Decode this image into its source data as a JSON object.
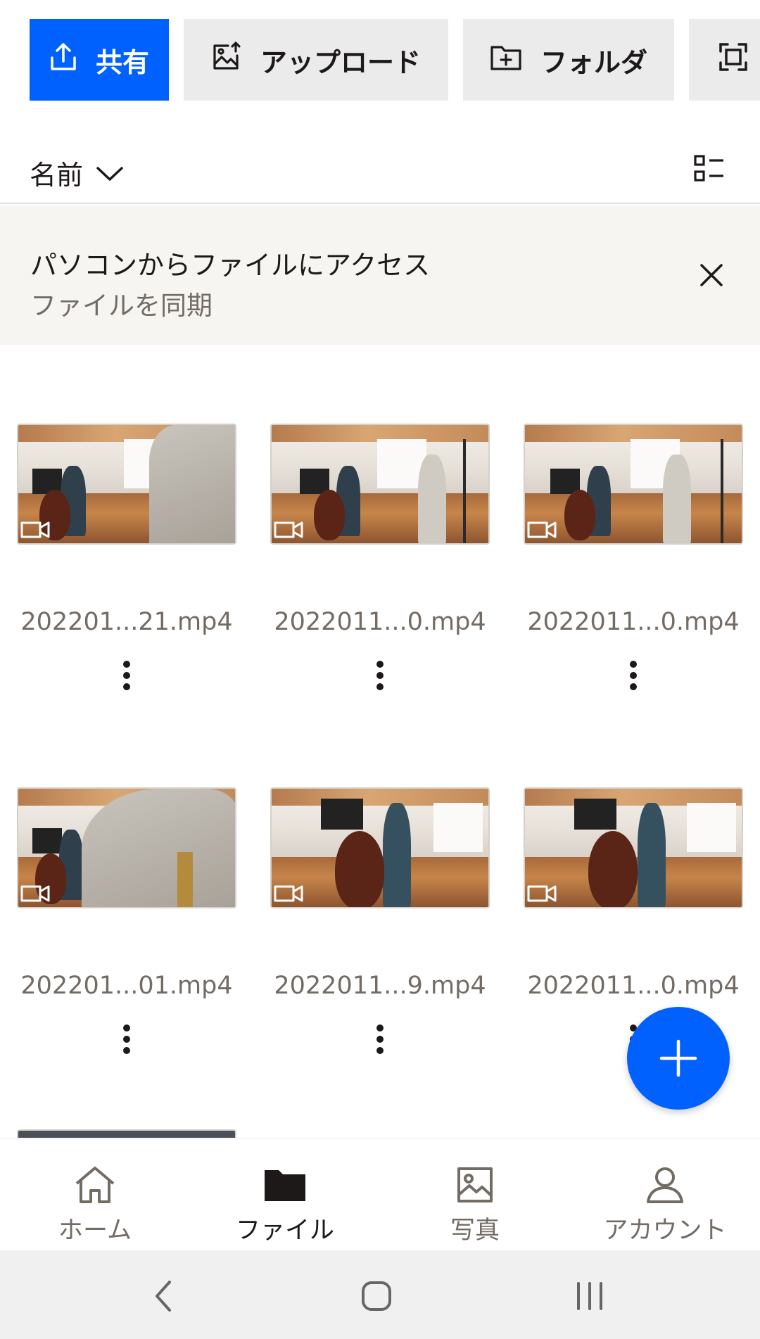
{
  "toolbar": {
    "share_label": "共有",
    "upload_label": "アップロード",
    "folder_label": "フォルダ",
    "accent_color": "#0061fe"
  },
  "sort": {
    "label": "名前"
  },
  "banner": {
    "title": "パソコンからファイルにアクセス",
    "subtitle": "ファイルを同期"
  },
  "files": [
    {
      "name": "202201...21.mp4",
      "type": "video"
    },
    {
      "name": "2022011...0.mp4",
      "type": "video"
    },
    {
      "name": "2022011...0.mp4",
      "type": "video"
    },
    {
      "name": "202201...01.mp4",
      "type": "video"
    },
    {
      "name": "2022011...9.mp4",
      "type": "video"
    },
    {
      "name": "2022011...0.mp4",
      "type": "video"
    }
  ],
  "nav": {
    "items": [
      {
        "label": "ホーム",
        "icon": "home-icon"
      },
      {
        "label": "ファイル",
        "icon": "folder-icon",
        "active": true
      },
      {
        "label": "写真",
        "icon": "photo-icon"
      },
      {
        "label": "アカウント",
        "icon": "account-icon"
      }
    ]
  }
}
